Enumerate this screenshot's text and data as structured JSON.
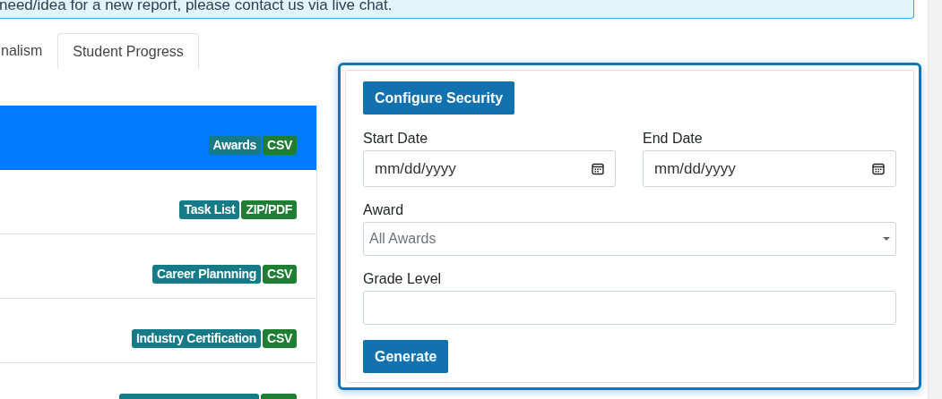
{
  "alert": {
    "text": "need/idea for a new report, please contact us via live chat."
  },
  "tabs": [
    {
      "label": "nalism",
      "selected": false
    },
    {
      "label": "Student Progress",
      "selected": true
    }
  ],
  "reports": [
    {
      "selected": true,
      "tags": [
        {
          "label": "Awards",
          "kind": "category"
        },
        {
          "label": "CSV",
          "kind": "format"
        }
      ]
    },
    {
      "selected": false,
      "tags": [
        {
          "label": "Task List",
          "kind": "category"
        },
        {
          "label": "ZIP/PDF",
          "kind": "format"
        }
      ]
    },
    {
      "selected": false,
      "tags": [
        {
          "label": "Career Plannning",
          "kind": "category"
        },
        {
          "label": "CSV",
          "kind": "format"
        }
      ]
    },
    {
      "selected": false,
      "tags": [
        {
          "label": "Industry Certification",
          "kind": "category"
        },
        {
          "label": "CSV",
          "kind": "format"
        }
      ]
    },
    {
      "selected": false,
      "tags": [
        {
          "kind": "category"
        },
        {
          "kind": "format"
        }
      ]
    }
  ],
  "form": {
    "configure_button": "Configure Security",
    "start_date": {
      "label": "Start Date",
      "placeholder": "mm/dd/yyyy"
    },
    "end_date": {
      "label": "End Date",
      "placeholder": "mm/dd/yyyy"
    },
    "award": {
      "label": "Award",
      "value": "All Awards"
    },
    "grade_level": {
      "label": "Grade Level"
    },
    "generate_button": "Generate"
  }
}
